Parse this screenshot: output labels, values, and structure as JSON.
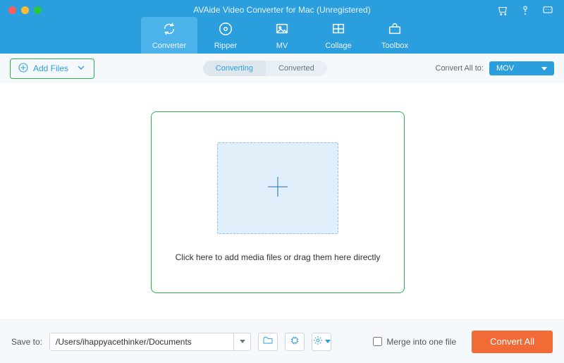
{
  "title": "AVAide Video Converter for Mac (Unregistered)",
  "tabs": {
    "converter": "Converter",
    "ripper": "Ripper",
    "mv": "MV",
    "collage": "Collage",
    "toolbox": "Toolbox"
  },
  "subbar": {
    "add_files": "Add Files",
    "converting": "Converting",
    "converted": "Converted",
    "convert_all_to": "Convert All to:",
    "format": "MOV"
  },
  "drop": {
    "hint": "Click here to add media files or drag them here directly"
  },
  "footer": {
    "save_to_label": "Save to:",
    "save_path": "/Users/ihappyacethinker/Documents",
    "merge_label": "Merge into one file",
    "convert_all": "Convert All"
  },
  "colors": {
    "accent": "#2b9ede",
    "primary_btn": "#f26a36",
    "highlight_border": "#2bb24c"
  }
}
